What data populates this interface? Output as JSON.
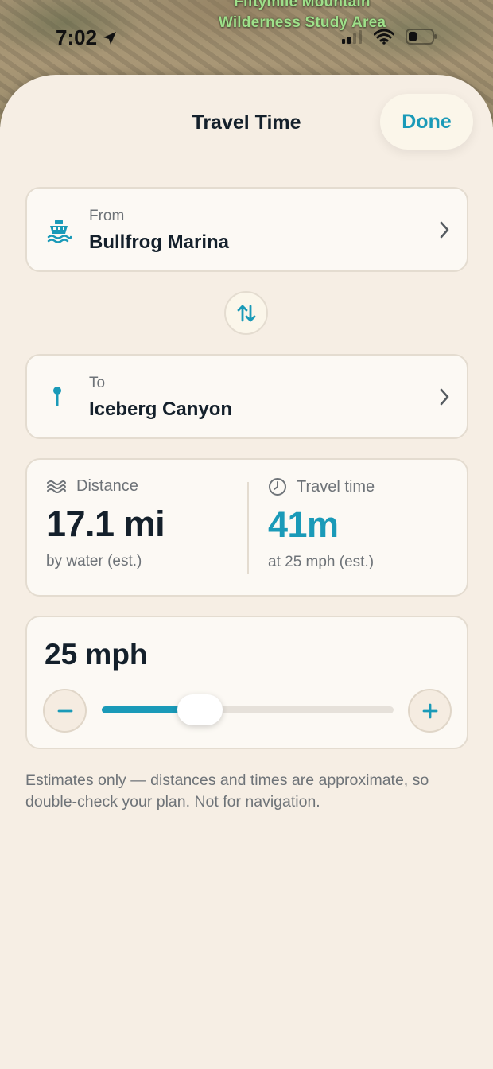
{
  "map": {
    "label_line1": "Fiftymile Mountain",
    "label_line2": "Wilderness Study Area"
  },
  "status_bar": {
    "time": "7:02"
  },
  "sheet": {
    "title": "Travel Time",
    "done_label": "Done"
  },
  "from": {
    "label": "From",
    "value": "Bullfrog Marina",
    "icon": "ferry-icon"
  },
  "to": {
    "label": "To",
    "value": "Iceberg Canyon",
    "icon": "pin-icon"
  },
  "swap": {
    "icon": "swap-vertical-icon"
  },
  "stats": {
    "distance": {
      "label": "Distance",
      "value": "17.1 mi",
      "sub": "by water (est.)",
      "icon": "waves-icon"
    },
    "travel_time": {
      "label": "Travel time",
      "value": "41m",
      "sub": "at 25 mph (est.)",
      "icon": "clock-icon"
    }
  },
  "speed": {
    "value_label": "25 mph",
    "slider_fraction": 0.26,
    "decrement_icon": "minus-icon",
    "increment_icon": "plus-icon"
  },
  "disclaimer": "Estimates only — distances and times are approximate, so double-check your plan. Not for navigation.",
  "colors": {
    "accent": "#1a9ab8",
    "text_primary": "#14202b",
    "text_secondary": "#6e7378",
    "sheet_bg": "#f6eee4",
    "card_bg": "#fcf9f4"
  }
}
